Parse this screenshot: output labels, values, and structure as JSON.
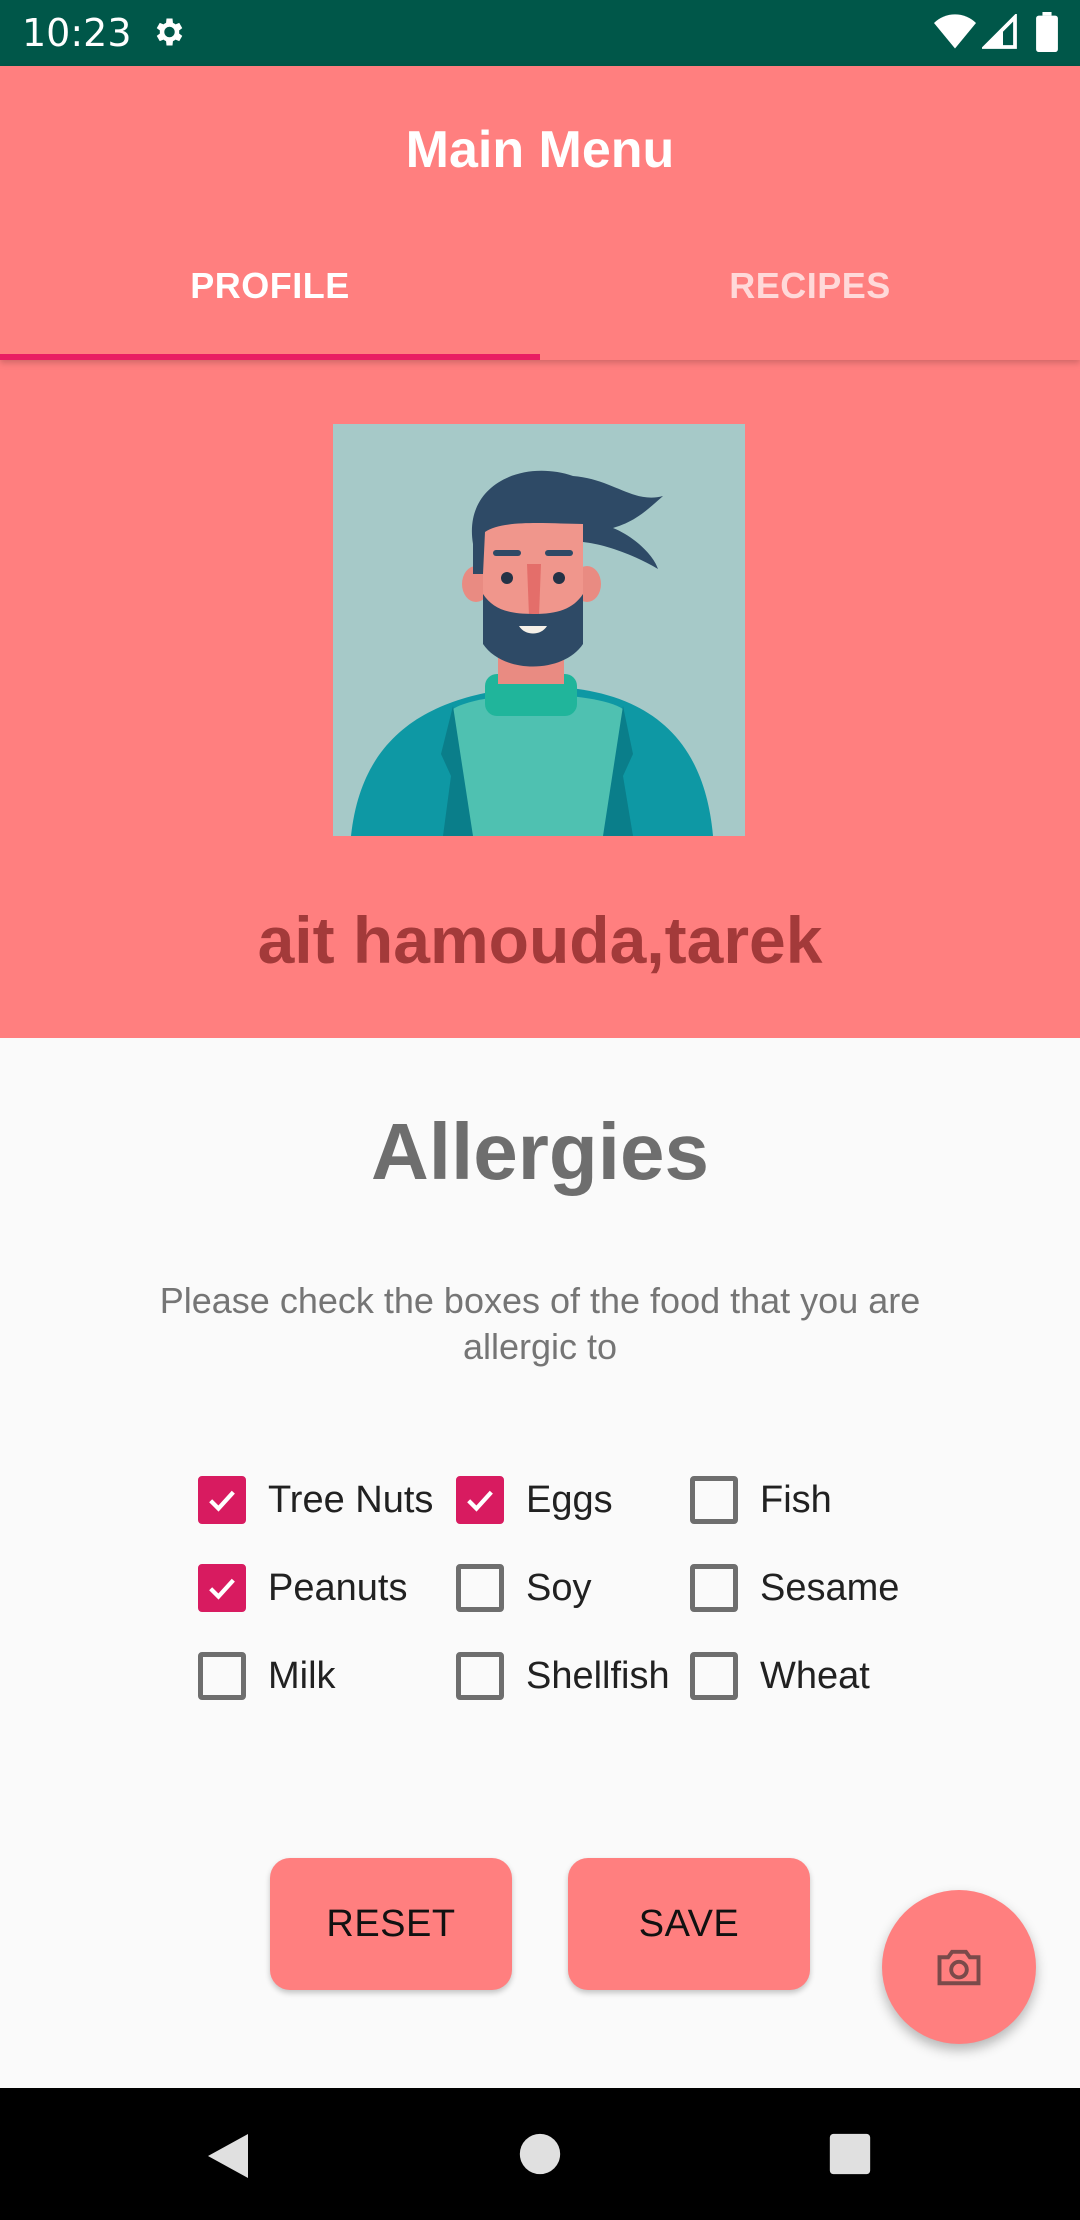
{
  "status_bar": {
    "time": "10:23",
    "icons": [
      "gear-icon",
      "wifi-icon",
      "signal-icon",
      "battery-icon"
    ]
  },
  "app_bar": {
    "title": "Main Menu",
    "tabs": [
      {
        "label": "PROFILE",
        "selected": true
      },
      {
        "label": "RECIPES",
        "selected": false
      }
    ]
  },
  "profile": {
    "name": "ait hamouda,tarek"
  },
  "allergies": {
    "title": "Allergies",
    "description": "Please check the boxes of the food that you are allergic to",
    "items": [
      {
        "label": "Tree Nuts",
        "checked": true
      },
      {
        "label": "Eggs",
        "checked": true
      },
      {
        "label": "Fish",
        "checked": false
      },
      {
        "label": "Peanuts",
        "checked": true
      },
      {
        "label": "Soy",
        "checked": false
      },
      {
        "label": "Sesame",
        "checked": false
      },
      {
        "label": "Milk",
        "checked": false
      },
      {
        "label": "Shellfish",
        "checked": false
      },
      {
        "label": "Wheat",
        "checked": false
      }
    ]
  },
  "buttons": {
    "reset": "RESET",
    "save": "SAVE"
  },
  "fab": {
    "icon": "camera-icon"
  },
  "nav_bar": {
    "icons": [
      "back-icon",
      "home-icon",
      "recents-icon"
    ]
  },
  "colors": {
    "primary": "#FF7F7F",
    "accent": "#D81B60",
    "status_bar": "#005749",
    "name_text": "#A33A3A"
  }
}
